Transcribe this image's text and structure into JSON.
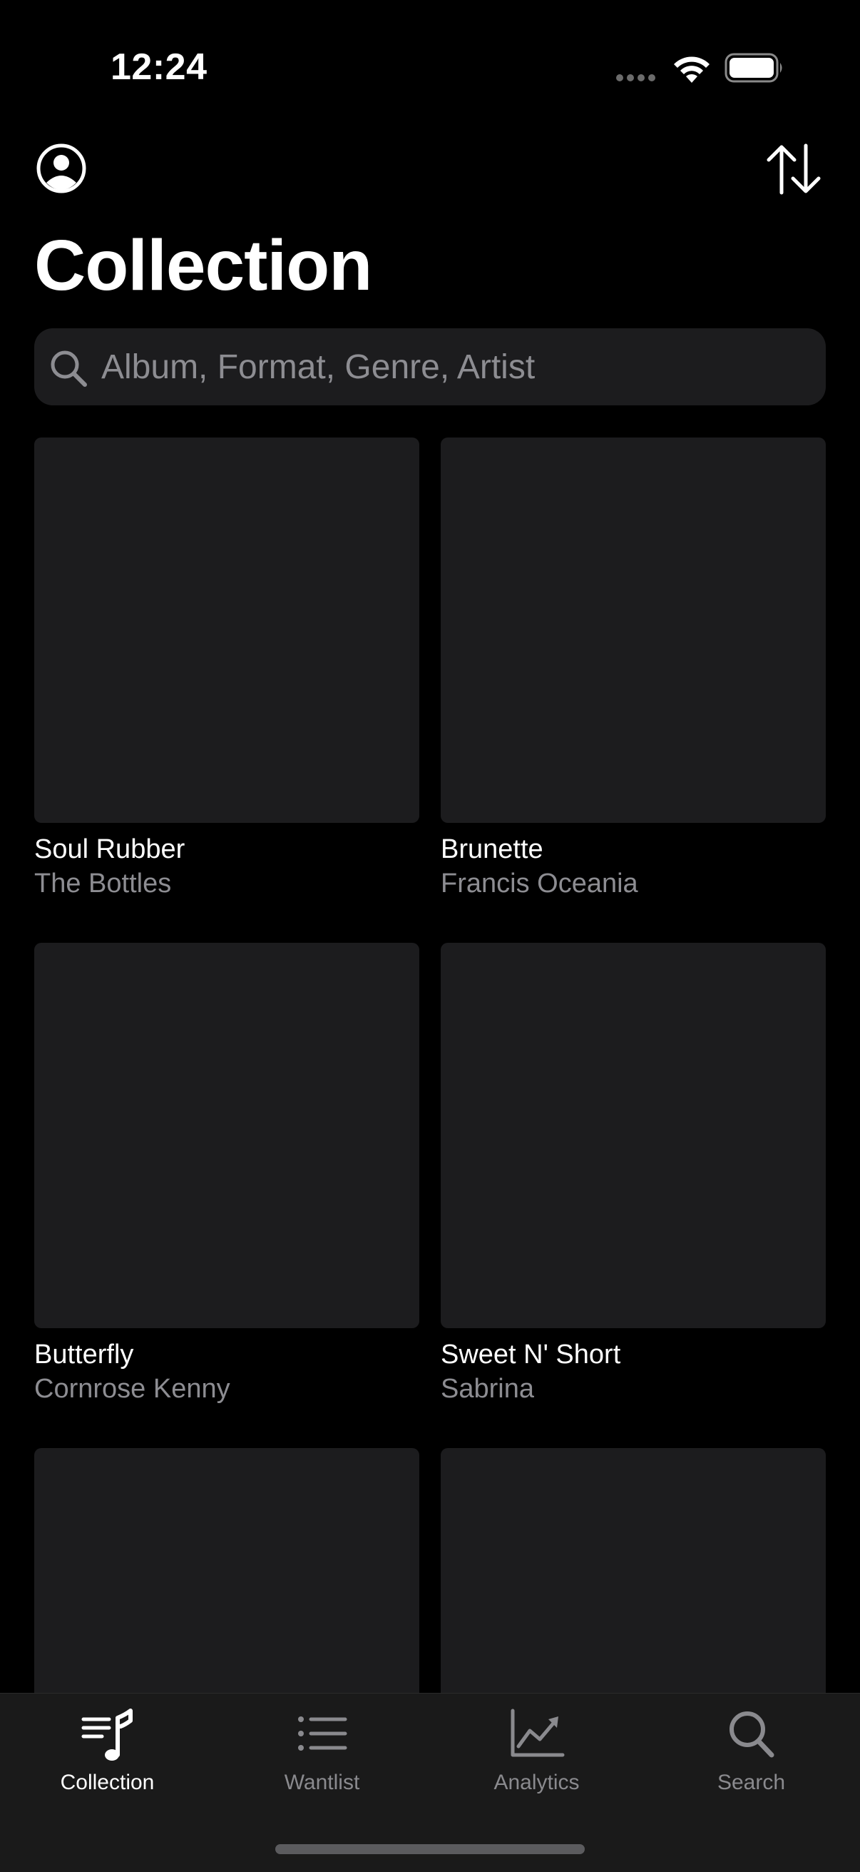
{
  "status_bar": {
    "time": "12:24",
    "icons": [
      "signal-dots-icon",
      "wifi-icon",
      "battery-icon"
    ]
  },
  "nav": {
    "profile_icon": "person-circle-icon",
    "sort_icon": "sort-arrows-icon"
  },
  "page": {
    "title": "Collection"
  },
  "search": {
    "placeholder": "Album, Format, Genre, Artist",
    "value": "",
    "icon": "search-icon"
  },
  "albums": [
    {
      "title": "Soul Rubber",
      "artist": "The Bottles"
    },
    {
      "title": "Brunette",
      "artist": "Francis Oceania"
    },
    {
      "title": "Butterfly",
      "artist": "Cornrose Kenny"
    },
    {
      "title": "Sweet N' Short",
      "artist": "Sabrina"
    },
    {
      "title": "",
      "artist": ""
    },
    {
      "title": "",
      "artist": ""
    }
  ],
  "tab_bar": {
    "tabs": [
      {
        "label": "Collection",
        "icon": "music-list-icon",
        "active": true
      },
      {
        "label": "Wantlist",
        "icon": "list-icon",
        "active": false
      },
      {
        "label": "Analytics",
        "icon": "chart-icon",
        "active": false
      },
      {
        "label": "Search",
        "icon": "magnifier-icon",
        "active": false
      }
    ]
  },
  "colors": {
    "background": "#000000",
    "card": "#1c1c1e",
    "secondary_text": "#8d8d92",
    "tab_bar": "#1a1a1a",
    "active_tab": "#ffffff",
    "inactive_tab": "#8a8a8e"
  }
}
